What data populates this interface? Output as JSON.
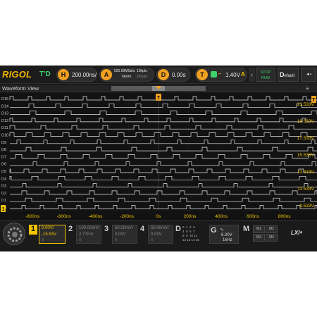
{
  "topbar": {
    "logo": "RIGOL",
    "mode": "T'D",
    "horizontal": {
      "icon_letter": "H",
      "value": "200.00ns/"
    },
    "acquire": {
      "icon_letter": "A",
      "sample_rate": "625.00MSa/s",
      "mode": "Norm",
      "points": "10kpts",
      "display": "2ms/pt"
    },
    "delay": {
      "icon_letter": "D",
      "value": "0.00s"
    },
    "trigger": {
      "icon_letter": "T",
      "level": "1.40V",
      "source": "A"
    },
    "run_stop": {
      "line1": "STOP",
      "line2": "RUN"
    },
    "default": {
      "big": "D",
      "small": "efault"
    },
    "right_chip": "◄▪"
  },
  "waveform_view": {
    "title": "Waveform View",
    "menu_icon": "hamburger-icon"
  },
  "plot": {
    "digital_channels": [
      "D15",
      "D14",
      "D13",
      "D12",
      "D11",
      "D10",
      "D9",
      "D8",
      "D7",
      "D6",
      "D5",
      "D4",
      "D3",
      "D2",
      "D1",
      "D0"
    ],
    "right_labels": [
      "21.533V",
      "19.533V",
      "17.533V",
      "15.533V",
      "13.533V",
      "11.533V",
      "9.533V"
    ],
    "time_labels": [
      "-800ns",
      "-600ns",
      "-400ns",
      "-200ns",
      "0s",
      "200ns",
      "400ns",
      "600ns",
      "800ns"
    ],
    "trigger_marker": "T",
    "channel_marker": "1",
    "colors": {
      "trace": "#e8e8e8",
      "grid": "#2c2c2c",
      "ch1": "#f2c400",
      "trigger": "#f0a020"
    }
  },
  "bottom": {
    "ch1": {
      "num": "1",
      "scale": "2.00V/",
      "offset": "-15.53V",
      "coupling": "≡"
    },
    "ch2": {
      "num": "2",
      "scale": "100.00mV/",
      "offset": "2.77mV",
      "coupling": "≡"
    },
    "ch3": {
      "num": "3",
      "scale": "50.00mV/",
      "offset": "0.00V",
      "coupling": "≡"
    },
    "ch4": {
      "num": "4",
      "scale": "50.00mV/",
      "offset": "0.00V",
      "coupling": "≡"
    },
    "digital": {
      "label": "D",
      "grid": "0  1  2  3\n4  5  6  7\n8  9  10 11\n12 13 14 15"
    },
    "generator": {
      "label": "G",
      "wave_icon": "sine-wave-icon",
      "amplitude": "6.00V",
      "frequency": "1kHz"
    },
    "math": {
      "label": "M",
      "cells": [
        "M1",
        "M2",
        "M3",
        "M4"
      ]
    },
    "lxi": "LXI",
    "speaker_icon": "speaker-icon"
  }
}
